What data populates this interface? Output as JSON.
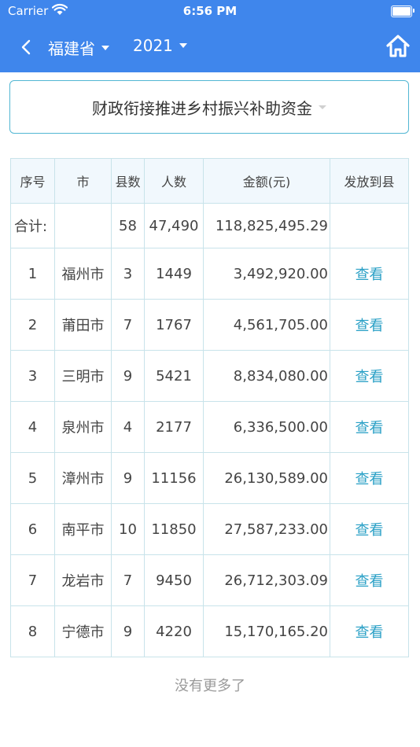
{
  "status_bar": {
    "carrier": "Carrier",
    "time": "6:56 PM"
  },
  "nav": {
    "province": "福建省",
    "year": "2021"
  },
  "fund_selector": {
    "label": "财政衔接推进乡村振兴补助资金"
  },
  "table": {
    "headers": [
      "序号",
      "市",
      "县数",
      "人数",
      "金额(元)",
      "发放到县"
    ],
    "total": {
      "label": "合计:",
      "city": "",
      "counties": "58",
      "people": "47,490",
      "amount": "118,825,495.29",
      "action": ""
    },
    "rows": [
      {
        "no": "1",
        "city": "福州市",
        "counties": "3",
        "people": "1449",
        "amount": "3,492,920.00",
        "action": "查看"
      },
      {
        "no": "2",
        "city": "莆田市",
        "counties": "7",
        "people": "1767",
        "amount": "4,561,705.00",
        "action": "查看"
      },
      {
        "no": "3",
        "city": "三明市",
        "counties": "9",
        "people": "5421",
        "amount": "8,834,080.00",
        "action": "查看"
      },
      {
        "no": "4",
        "city": "泉州市",
        "counties": "4",
        "people": "2177",
        "amount": "6,336,500.00",
        "action": "查看"
      },
      {
        "no": "5",
        "city": "漳州市",
        "counties": "9",
        "people": "11156",
        "amount": "26,130,589.00",
        "action": "查看"
      },
      {
        "no": "6",
        "city": "南平市",
        "counties": "10",
        "people": "11850",
        "amount": "27,587,233.00",
        "action": "查看"
      },
      {
        "no": "7",
        "city": "龙岩市",
        "counties": "7",
        "people": "9450",
        "amount": "26,712,303.09",
        "action": "查看"
      },
      {
        "no": "8",
        "city": "宁德市",
        "counties": "9",
        "people": "4220",
        "amount": "15,170,165.20",
        "action": "查看"
      }
    ]
  },
  "footer": {
    "no_more": "没有更多了"
  },
  "colors": {
    "header_bg": "#3f86ec",
    "link": "#2aa0c6",
    "border": "#c8e3ea",
    "header_row_bg": "#f1f8fd"
  },
  "icons": [
    "wifi-icon",
    "battery-icon",
    "back-arrow-icon",
    "home-icon",
    "caret-down-icon"
  ]
}
